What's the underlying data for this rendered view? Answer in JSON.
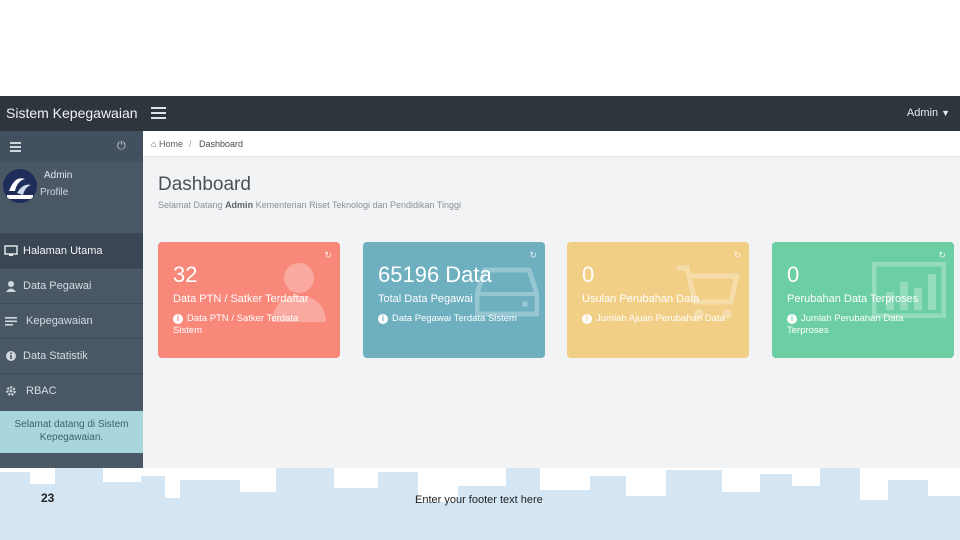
{
  "topbar": {
    "brand": "Sistem Kepegawaian",
    "user": "Admin"
  },
  "sidebar": {
    "user_name": "Admin",
    "user_profile": "Profile",
    "items": [
      {
        "label": "Halaman Utama",
        "icon": "desktop-icon",
        "active": true
      },
      {
        "label": "Data Pegawai",
        "icon": "user-icon"
      },
      {
        "label": "Kepegawaian",
        "icon": "list-icon"
      },
      {
        "label": "Data Statistik",
        "icon": "info-icon"
      },
      {
        "label": "RBAC",
        "icon": "gear-icon"
      }
    ],
    "welcome": "Selamat datang di Sistem Kepegawaian."
  },
  "breadcrumb": {
    "home": "Home",
    "separator": "/",
    "current": "Dashboard"
  },
  "page": {
    "title": "Dashboard",
    "subtitle_prefix": "Selamat Datang",
    "subtitle_user": "Admin",
    "subtitle_suffix": "Kementerian Riset Teknologi dan Pendidikan Tinggi"
  },
  "cards": [
    {
      "value": "32",
      "title": "Data PTN / Satker Terdaftar",
      "info": "Data PTN / Satker Terdata Sistem",
      "color": "#f7887a",
      "icon": "user-icon"
    },
    {
      "value": "65196 Data",
      "title": "Total Data Pegawai",
      "info": "Data Pegawai Terdata Sistem",
      "color": "#6eb0c0",
      "icon": "hdd-icon"
    },
    {
      "value": "0",
      "title": "Usulan Perubahan Data",
      "info": "Jumlah Ajuan Perubahan Data",
      "color": "#f2cf86",
      "icon": "cart-icon"
    },
    {
      "value": "0",
      "title": "Perubahan Data Terproses",
      "info": "Jumlah Perubahan Data Terproses",
      "color": "#6ccfa3",
      "icon": "bar-chart-icon"
    }
  ],
  "footer": {
    "page_number": "23",
    "text": "Enter your footer text here"
  },
  "colors": {
    "topbar": "#2f353d",
    "sidebar": "#4a5866",
    "skyline": "#d4e6f4"
  }
}
